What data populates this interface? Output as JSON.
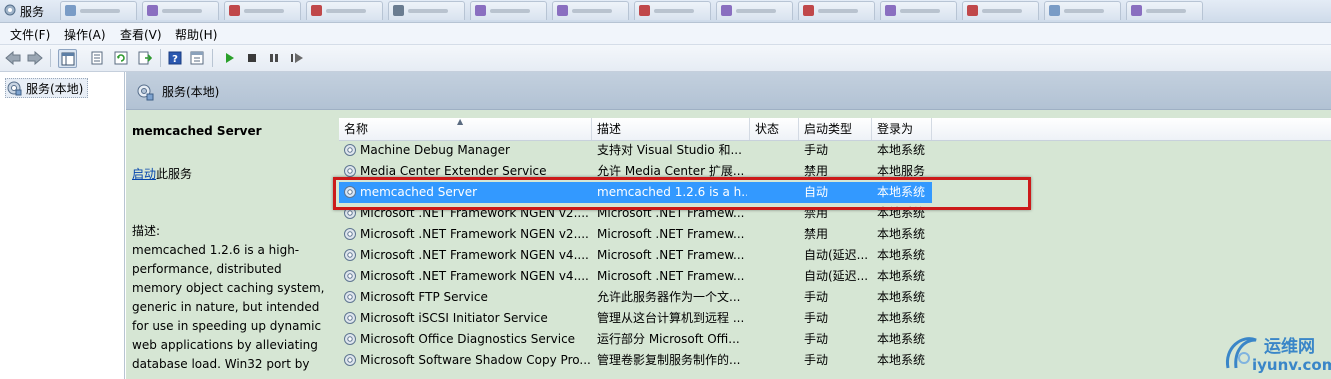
{
  "window": {
    "title": "服务"
  },
  "menu": [
    "文件(F)",
    "操作(A)",
    "查看(V)",
    "帮助(H)"
  ],
  "toolbar": {
    "buttons": [
      "back-icon",
      "forward-icon",
      "console-tree-icon",
      "properties-icon",
      "refresh-icon",
      "export-icon",
      "help-icon",
      "view-icon",
      "start-icon",
      "stop-icon",
      "pause-icon",
      "restart-icon"
    ]
  },
  "tree": {
    "root": "服务(本地)"
  },
  "panel": {
    "header": "服务(本地)"
  },
  "detail": {
    "service_name": "memcached Server",
    "action_link": "启动",
    "action_suffix": "此服务",
    "desc_label": "描述:",
    "description": "memcached 1.2.6 is a high-performance, distributed memory object caching system, generic in nature, but intended for use in speeding up dynamic web applications by alleviating database load. Win32 port by"
  },
  "columns": [
    "名称",
    "描述",
    "状态",
    "启动类型",
    "登录为"
  ],
  "rows": [
    {
      "name": "Machine Debug Manager",
      "desc": "支持对 Visual Studio 和...",
      "status": "",
      "startup": "手动",
      "logon": "本地系统"
    },
    {
      "name": "Media Center Extender Service",
      "desc": "允许 Media Center 扩展...",
      "status": "",
      "startup": "禁用",
      "logon": "本地服务"
    },
    {
      "name": "memcached Server",
      "desc": "memcached 1.2.6 is a h...",
      "status": "",
      "startup": "自动",
      "logon": "本地系统"
    },
    {
      "name": "Microsoft .NET Framework NGEN v2....",
      "desc": "Microsoft .NET Framew...",
      "status": "",
      "startup": "禁用",
      "logon": "本地系统"
    },
    {
      "name": "Microsoft .NET Framework NGEN v2....",
      "desc": "Microsoft .NET Framew...",
      "status": "",
      "startup": "禁用",
      "logon": "本地系统"
    },
    {
      "name": "Microsoft .NET Framework NGEN v4....",
      "desc": "Microsoft .NET Framew...",
      "status": "",
      "startup": "自动(延迟...",
      "logon": "本地系统"
    },
    {
      "name": "Microsoft .NET Framework NGEN v4....",
      "desc": "Microsoft .NET Framew...",
      "status": "",
      "startup": "自动(延迟...",
      "logon": "本地系统"
    },
    {
      "name": "Microsoft FTP Service",
      "desc": "允许此服务器作为一个文...",
      "status": "",
      "startup": "手动",
      "logon": "本地系统"
    },
    {
      "name": "Microsoft iSCSI Initiator Service",
      "desc": "管理从这台计算机到远程 ...",
      "status": "",
      "startup": "手动",
      "logon": "本地系统"
    },
    {
      "name": "Microsoft Office Diagnostics Service",
      "desc": "运行部分 Microsoft Offi...",
      "status": "",
      "startup": "手动",
      "logon": "本地系统"
    },
    {
      "name": "Microsoft Software Shadow Copy Pro...",
      "desc": "管理卷影复制服务制作的...",
      "status": "",
      "startup": "手动",
      "logon": "本地系统"
    }
  ],
  "watermark": {
    "cn": "运维网",
    "en": "iyunv.com"
  },
  "colors": {
    "selection": "#3399ff",
    "highlight_box": "#cc1a1a",
    "panel_bg": "#d6e6d4",
    "header_bg": "#b9c8d8"
  }
}
